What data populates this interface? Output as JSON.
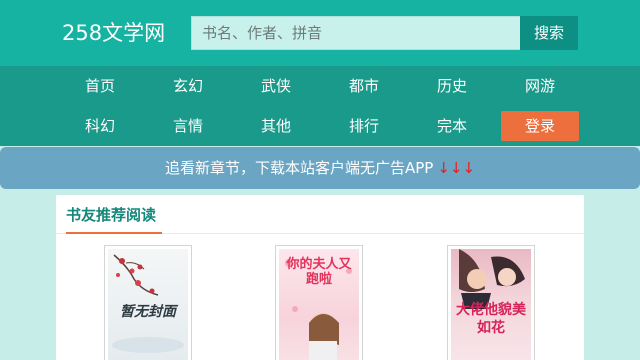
{
  "header": {
    "logo": "258文学网",
    "search_placeholder": "书名、作者、拼音",
    "search_button": "搜索"
  },
  "nav": {
    "row1": [
      "首页",
      "玄幻",
      "武侠",
      "都市",
      "历史",
      "网游"
    ],
    "row2": [
      "科幻",
      "言情",
      "其他",
      "排行",
      "完本",
      "登录"
    ]
  },
  "banner": {
    "text": "追看新章节，下载本站客户端无广告APP",
    "arrows": "↓↓↓"
  },
  "recommend": {
    "title": "书友推荐阅读",
    "books": [
      {
        "cover_text": "暂无封面"
      },
      {
        "cover_text": "你的夫人又跑啦"
      },
      {
        "cover_text": "大佬他貌美如花"
      }
    ]
  },
  "colors": {
    "header_bg": "#16b3a2",
    "nav_bg": "#1a9a8b",
    "login_accent": "#ee6f3e",
    "banner_bg": "#6aa5c4",
    "page_bg": "#c7ede8"
  }
}
